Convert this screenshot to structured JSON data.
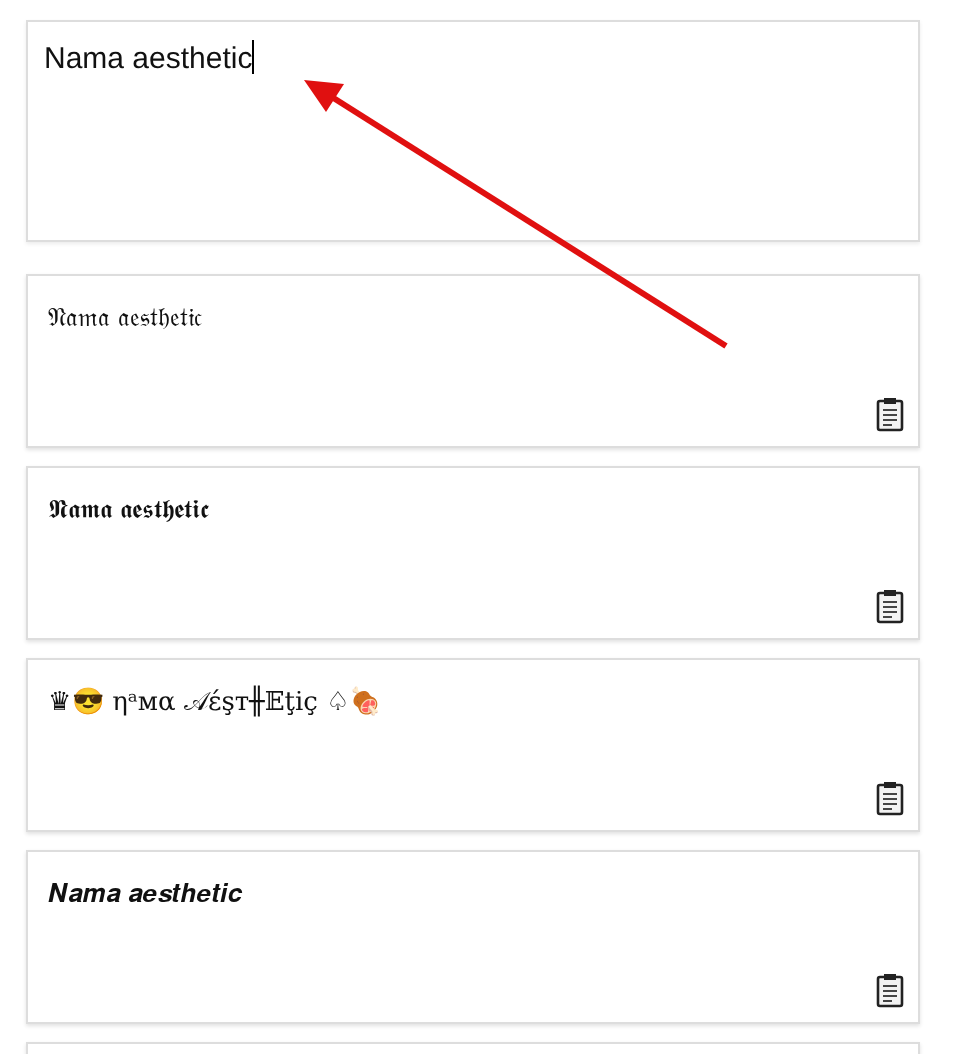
{
  "input": {
    "value": "Nama aesthetic"
  },
  "results": [
    {
      "text": "𝔑𝔞𝔪𝔞 𝔞𝔢𝔰𝔱𝔥𝔢𝔱𝔦𝔠"
    },
    {
      "text": "𝕹𝖆𝖒𝖆 𝖆𝖊𝖘𝖙𝖍𝖊𝖙𝖎𝖈"
    },
    {
      "text": "♛😎  ηᵃмα 𝒜έşт╫𝔼ţiç ♤🍖"
    },
    {
      "text": "𝑵𝒂𝒎𝒂 𝒂𝒆𝒔𝒕𝒉𝒆𝒕𝒊𝒄"
    }
  ]
}
